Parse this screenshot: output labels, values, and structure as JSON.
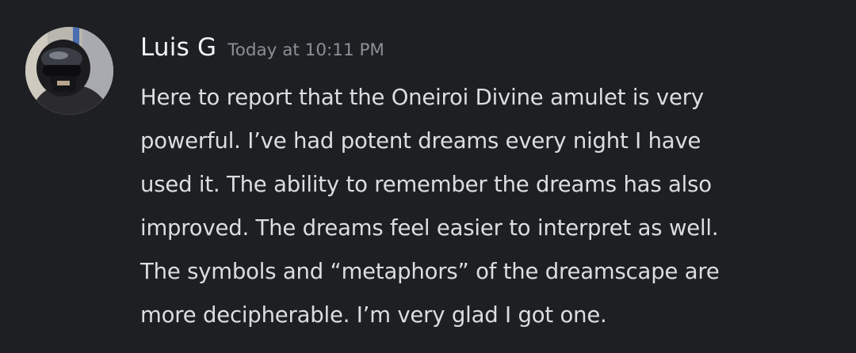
{
  "message": {
    "author": "Luis G",
    "timestamp": "Today at 10:11 PM",
    "lines": [
      "Here to report that the Oneiroi Divine amulet is very",
      "powerful. I’ve had potent dreams every night I have",
      "used it. The ability to remember the dreams has also",
      "improved. The dreams feel easier to interpret as well.",
      "The symbols and “metaphors” of the dreamscape are",
      "more decipherable. I’m very glad I got one."
    ]
  },
  "colors": {
    "background": "#1e1f23",
    "username": "#f2f3f5",
    "timestamp": "#8c8f96",
    "text": "#dbdee1"
  }
}
